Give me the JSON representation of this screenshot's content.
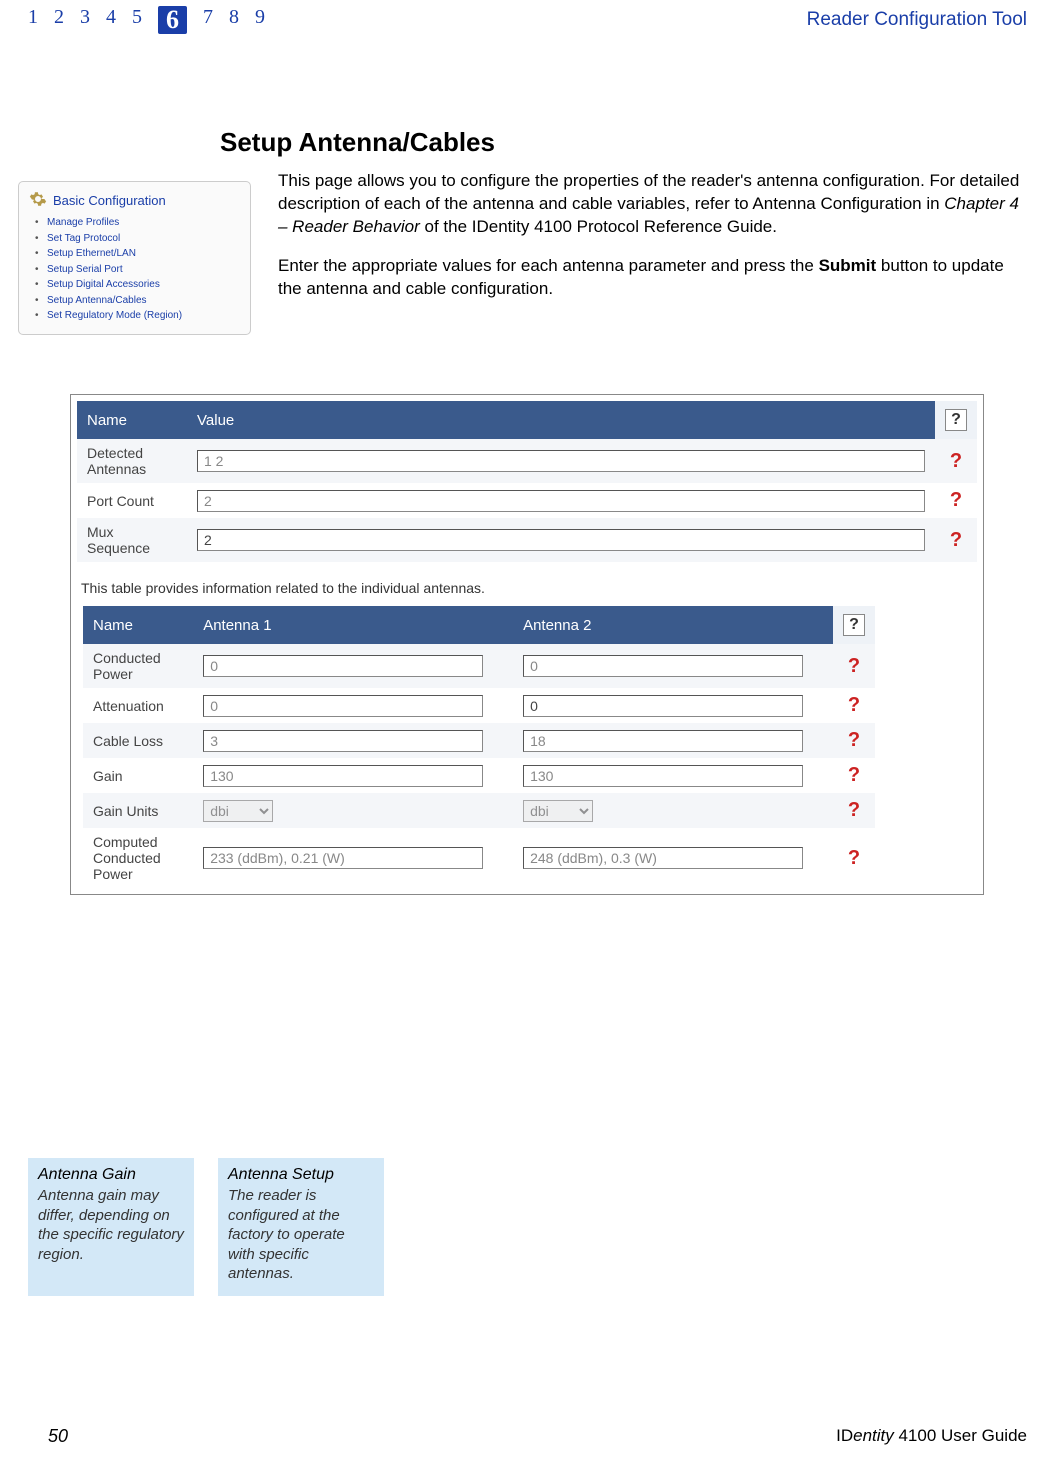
{
  "header": {
    "page_numbers": [
      "1",
      "2",
      "3",
      "4",
      "5",
      "6",
      "7",
      "8",
      "9"
    ],
    "current_page_index": 5,
    "tool_name": "Reader Configuration Tool"
  },
  "section_heading": "Setup Antenna/Cables",
  "intro": {
    "p1_a": "This page allows you to configure the properties of the reader's antenna configuration. For detailed description of each of the antenna and cable variables, refer to Antenna Configuration in ",
    "p1_chapter": "Chapter 4 – Reader Behavior",
    "p1_b": " of the ",
    "p1_guide": "IDentity 4100 Protocol Reference Guide",
    "p1_c": ".",
    "p2_a": "Enter the appropriate values for each antenna parameter and press the ",
    "p2_btn": "Submit",
    "p2_b": " button to update the antenna and cable configuration."
  },
  "sidebar": {
    "title": "Basic Configuration",
    "items": [
      "Manage Profiles",
      "Set Tag Protocol",
      "Setup Ethernet/LAN",
      "Setup Serial Port",
      "Setup Digital Accessories",
      "Setup Antenna/Cables",
      "Set Regulatory Mode (Region)"
    ]
  },
  "table1": {
    "headers": {
      "name": "Name",
      "value": "Value"
    },
    "rows": [
      {
        "label": "Detected Antennas",
        "value": "1 2",
        "disabled": true
      },
      {
        "label": "Port Count",
        "value": "2",
        "disabled": true
      },
      {
        "label": "Mux Sequence",
        "value": "2",
        "disabled": false
      }
    ]
  },
  "panel_note": "This table provides information related to the individual antennas.",
  "table2": {
    "headers": {
      "name": "Name",
      "a1": "Antenna 1",
      "a2": "Antenna 2"
    },
    "rows": [
      {
        "label": "Conducted Power",
        "a1": "0",
        "a2": "0",
        "a1_disabled": true,
        "a2_disabled": true,
        "type": "text"
      },
      {
        "label": "Attenuation",
        "a1": "0",
        "a2": "0",
        "a1_disabled": true,
        "a2_disabled": false,
        "type": "text"
      },
      {
        "label": "Cable Loss",
        "a1": "3",
        "a2": "18",
        "a1_disabled": true,
        "a2_disabled": true,
        "type": "text"
      },
      {
        "label": "Gain",
        "a1": "130",
        "a2": "130",
        "a1_disabled": true,
        "a2_disabled": true,
        "type": "text"
      },
      {
        "label": "Gain Units",
        "a1": "dbi",
        "a2": "dbi",
        "type": "select"
      },
      {
        "label": "Computed Conducted Power",
        "a1": "233 (ddBm), 0.21 (W)",
        "a2": "248 (ddBm), 0.3 (W)",
        "a1_disabled": true,
        "a2_disabled": true,
        "type": "text"
      }
    ]
  },
  "callouts": [
    {
      "title": "Antenna Gain",
      "body": "Antenna gain may differ, depending on the specific regulatory region."
    },
    {
      "title": "Antenna Setup",
      "body": "The reader is configured at the factory to operate with specific antennas."
    }
  ],
  "footer": {
    "page_number": "50",
    "guide_prefix": "ID",
    "guide_mid": "entity",
    "guide_suffix": " 4100 User Guide"
  },
  "help": {
    "qmark": "?"
  }
}
